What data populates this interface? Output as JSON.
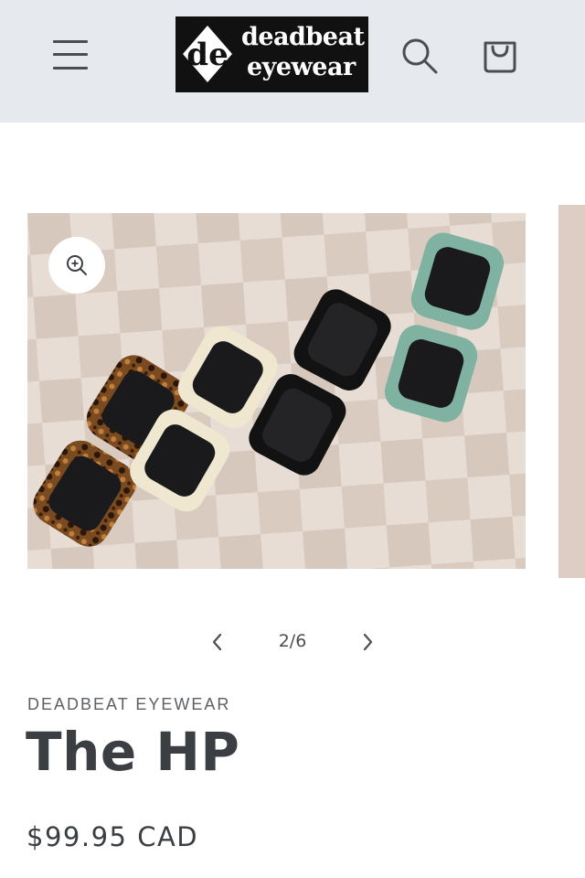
{
  "header": {
    "logo": {
      "line1": "deadbeat",
      "line2": "eyewear",
      "mark": "de"
    },
    "menu_icon": "hamburger-menu-icon",
    "search_icon": "search-icon",
    "cart_icon": "shopping-bag-icon",
    "background": "#e6e9ee"
  },
  "gallery": {
    "current": "2/6",
    "zoom_icon": "zoom-in-icon",
    "prev_icon": "chevron-left-icon",
    "next_icon": "chevron-right-icon",
    "image_subject": "four-pairs-of-sunglasses"
  },
  "product": {
    "vendor": "DEADBEAT EYEWEAR",
    "title": "The HP",
    "price": "$99.95 CAD"
  },
  "colors": {
    "text": "#3b3f44",
    "frame_tortoise": "#6b3f1c",
    "frame_cream": "#efe7cf",
    "frame_black": "#121212",
    "frame_green": "#7fb2a0"
  }
}
